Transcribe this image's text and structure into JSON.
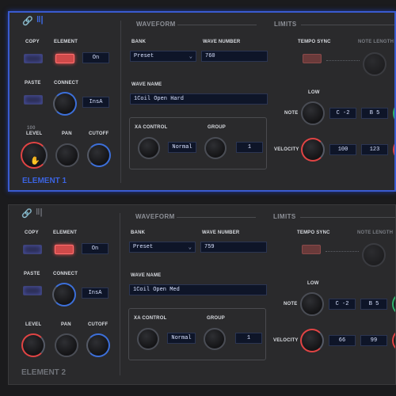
{
  "elements": [
    {
      "title": "ELEMENT 1",
      "copy_label": "COPY",
      "paste_label": "PASTE",
      "element_label": "ELEMENT",
      "element_value": "On",
      "connect_label": "CONNECT",
      "connect_value": "InsA",
      "level_label": "LEVEL",
      "level_value": "100",
      "pan_label": "PAN",
      "cutoff_label": "CUTOFF",
      "waveform": {
        "section": "WAVEFORM",
        "bank_label": "BANK",
        "bank_value": "Preset",
        "wave_number_label": "WAVE NUMBER",
        "wave_number_value": "760",
        "wave_name_label": "WAVE NAME",
        "wave_name_value": "1Coil Open Hard",
        "xa_control_label": "XA CONTROL",
        "xa_control_value": "Normal",
        "group_label": "GROUP",
        "group_value": "1"
      },
      "limits": {
        "section": "LIMITS",
        "tempo_sync_label": "TEMPO SYNC",
        "note_length_label": "NOTE LENGTH",
        "low_label": "LOW",
        "note_label": "NOTE",
        "note_low": "C -2",
        "note_high": "B 5",
        "velocity_label": "VELOCITY",
        "velocity_low": "100",
        "velocity_high": "123"
      }
    },
    {
      "title": "ELEMENT 2",
      "copy_label": "COPY",
      "paste_label": "PASTE",
      "element_label": "ELEMENT",
      "element_value": "On",
      "connect_label": "CONNECT",
      "connect_value": "InsA",
      "level_label": "LEVEL",
      "pan_label": "PAN",
      "cutoff_label": "CUTOFF",
      "waveform": {
        "section": "WAVEFORM",
        "bank_label": "BANK",
        "bank_value": "Preset",
        "wave_number_label": "WAVE NUMBER",
        "wave_number_value": "759",
        "wave_name_label": "WAVE NAME",
        "wave_name_value": "1Coil Open Med",
        "xa_control_label": "XA CONTROL",
        "xa_control_value": "Normal",
        "group_label": "GROUP",
        "group_value": "1"
      },
      "limits": {
        "section": "LIMITS",
        "tempo_sync_label": "TEMPO SYNC",
        "note_length_label": "NOTE LENGTH",
        "low_label": "LOW",
        "note_label": "NOTE",
        "note_low": "C -2",
        "note_high": "B 5",
        "velocity_label": "VELOCITY",
        "velocity_low": "66",
        "velocity_high": "99"
      }
    }
  ],
  "icons": [
    "link-icon",
    "bars-icon",
    "hand-cursor-icon",
    "chevron-down-icon"
  ],
  "colors": {
    "accent": "#3b63e0",
    "active_red": "#e04444",
    "lcd_bg": "#0e1528"
  }
}
